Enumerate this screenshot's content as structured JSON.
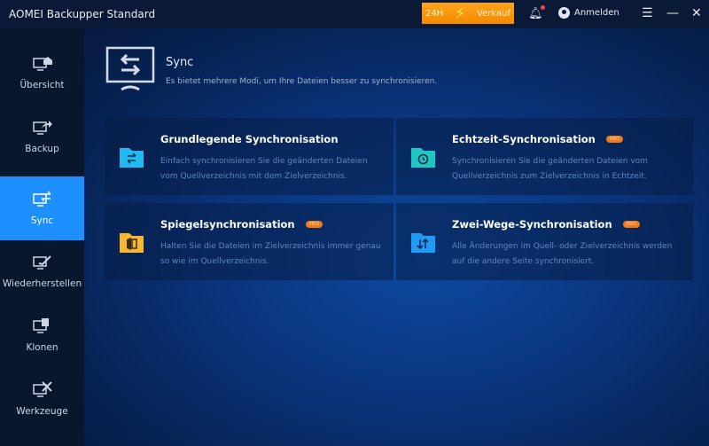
{
  "app": {
    "title": "AOMEI Backupper Standard"
  },
  "titlebar": {
    "promo_left": "24H",
    "promo_right": "Verkauf",
    "login": "Anmelden",
    "icons": [
      "bell-icon",
      "user-icon",
      "menu-icon",
      "minimize-icon",
      "close-icon"
    ]
  },
  "sidebar": {
    "items": [
      {
        "label": "Übersicht",
        "icon": "home-monitor-icon",
        "active": false
      },
      {
        "label": "Backup",
        "icon": "backup-monitor-icon",
        "active": false
      },
      {
        "label": "Sync",
        "icon": "sync-monitor-icon",
        "active": true
      },
      {
        "label": "Wiederherstellen",
        "icon": "restore-monitor-icon",
        "active": false
      },
      {
        "label": "Klonen",
        "icon": "clone-monitor-icon",
        "active": false
      },
      {
        "label": "Werkzeuge",
        "icon": "tools-monitor-icon",
        "active": false
      }
    ]
  },
  "header": {
    "title": "Sync",
    "subtitle": "Es bietet mehrere Modi, um Ihre Dateien besser zu synchronisieren."
  },
  "cards": [
    {
      "title": "Grundlegende Synchronisation",
      "pro": "",
      "desc1": "Einfach synchronisieren Sie die geänderten Dateien",
      "desc2": "vom Quellverzeichnis mit dem Zielverzeichnis.",
      "icon_color": "#22b8f0"
    },
    {
      "title": "Echtzeit-Synchronisation",
      "pro": "PRO",
      "desc1": "Synchronisieren Sie die geänderten Dateien vom",
      "desc2": "Quellverzeichnis zum Zielverzeichnis in Echtzeit.",
      "icon_color": "#1ec8c0"
    },
    {
      "title": "Spiegelsynchronisation",
      "pro": "PRO",
      "desc1": "Halten Sie die Dateien im Zielverzeichnis immer genau",
      "desc2": "so wie im Quellverzeichnis.",
      "icon_color": "#f5b830"
    },
    {
      "title": "Zwei-Wege-Synchronisation",
      "pro": "PRO",
      "desc1": "Alle Änderungen im Quell- oder Zielverzeichnis werden",
      "desc2": "auf die andere Seite synchronisiert.",
      "icon_color": "#1e9cf5"
    }
  ]
}
